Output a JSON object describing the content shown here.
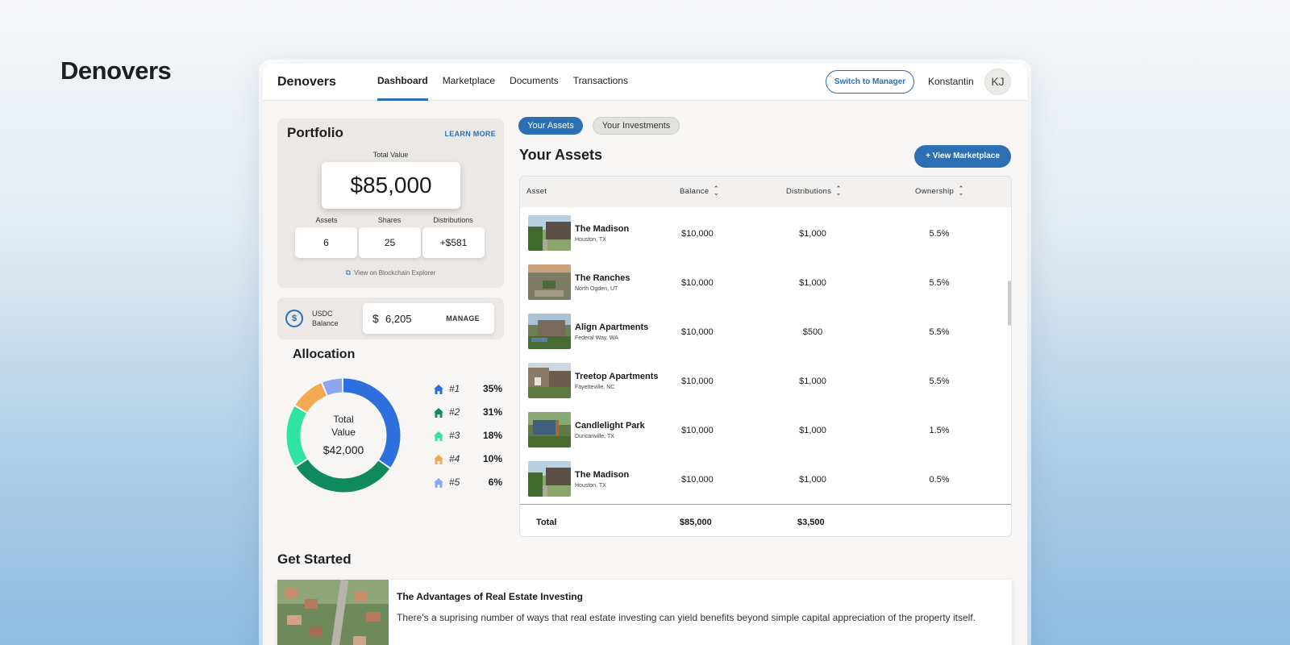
{
  "brand": "Denovers",
  "app": {
    "brand": "Denovers",
    "nav": [
      "Dashboard",
      "Marketplace",
      "Documents",
      "Transactions"
    ],
    "active_nav": "Dashboard",
    "switch_label": "Switch to Manager",
    "username": "Konstantin",
    "avatar_initials": "KJ"
  },
  "portfolio": {
    "title": "Portfolio",
    "learn_more": "LEARN MORE",
    "total_label": "Total Value",
    "total_value": "$85,000",
    "stats": [
      {
        "label": "Assets",
        "value": "6"
      },
      {
        "label": "Shares",
        "value": "25"
      },
      {
        "label": "Distributions",
        "value": "+$581"
      }
    ],
    "explorer_link": "View on Blockchain Explorer"
  },
  "usdc": {
    "label": "USDC Balance",
    "currency_symbol": "$",
    "value": "6,205",
    "manage_label": "MANAGE"
  },
  "allocation": {
    "title": "Allocation",
    "center_label": "Total Value",
    "center_value": "$42,000",
    "items": [
      {
        "rank": "#1",
        "percent": "35%",
        "share": 35,
        "color": "#2d6fdc"
      },
      {
        "rank": "#2",
        "percent": "31%",
        "share": 31,
        "color": "#0f8a5f"
      },
      {
        "rank": "#3",
        "percent": "18%",
        "share": 18,
        "color": "#2fe3a1"
      },
      {
        "rank": "#4",
        "percent": "10%",
        "share": 10,
        "color": "#f2a950"
      },
      {
        "rank": "#5",
        "percent": "6%",
        "share": 6,
        "color": "#8ea6ef"
      }
    ]
  },
  "tabs": [
    "Your Assets",
    "Your Investments"
  ],
  "assets": {
    "title": "Your Assets",
    "view_marketplace": "View Marketplace",
    "columns": [
      "Asset",
      "Balance",
      "Distributions",
      "Ownership"
    ],
    "rows": [
      {
        "name": "The Madison",
        "location": "Houston, TX",
        "balance": "$10,000",
        "distributions": "$1,000",
        "ownership": "5.5%"
      },
      {
        "name": "The Ranches",
        "location": "North Ogden, UT",
        "balance": "$10,000",
        "distributions": "$1,000",
        "ownership": "5.5%"
      },
      {
        "name": "Align Apartments",
        "location": "Federal Way, WA",
        "balance": "$10,000",
        "distributions": "$500",
        "ownership": "5.5%"
      },
      {
        "name": "Treetop Apartments",
        "location": "Fayetteville, NC",
        "balance": "$10,000",
        "distributions": "$1,000",
        "ownership": "5.5%"
      },
      {
        "name": "Candlelight Park",
        "location": "Duncanville, TX",
        "balance": "$10,000",
        "distributions": "$1,000",
        "ownership": "1.5%"
      },
      {
        "name": "The Madison",
        "location": "Houston, TX",
        "balance": "$10,000",
        "distributions": "$1,000",
        "ownership": "0.5%"
      }
    ],
    "total_label": "Total",
    "total_balance": "$85,000",
    "total_distributions": "$3,500"
  },
  "get_started": {
    "title": "Get Started",
    "card_title": "The Advantages of Real Estate Investing",
    "card_text": "There's a suprising number of ways that real estate investing can yield benefits beyond simple capital appreciation of the property itself."
  }
}
